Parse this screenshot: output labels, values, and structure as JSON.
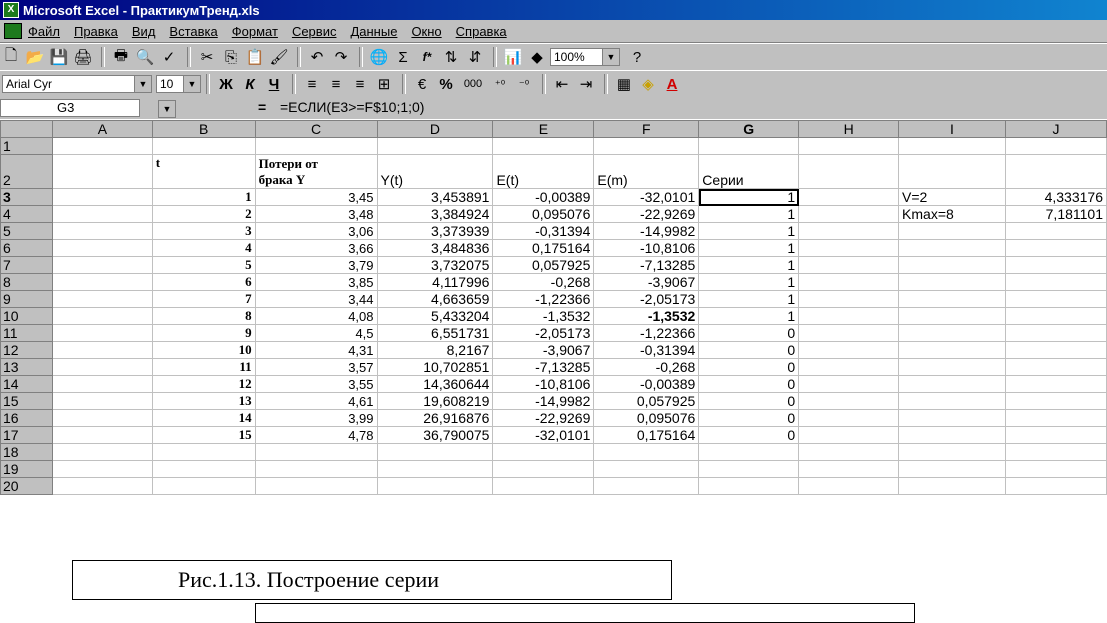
{
  "window": {
    "title": "Microsoft Excel - ПрактикумТренд.xls",
    "app_icon": "excel-icon"
  },
  "menu": [
    "Файл",
    "Правка",
    "Вид",
    "Вставка",
    "Формат",
    "Сервис",
    "Данные",
    "Окно",
    "Справка"
  ],
  "toolbar": {
    "zoom": "100%",
    "font": "Arial Cyr",
    "font_size": "10",
    "bold_label": "Ж",
    "italic_label": "К",
    "underline_label": "Ч",
    "percent": "%",
    "thousands": "000",
    "sigma": "Σ",
    "fx": "f*"
  },
  "formula_bar": {
    "cell_ref": "G3",
    "eq": "=",
    "formula": "=ЕСЛИ(E3>=F$10;1;0)"
  },
  "columns": [
    "A",
    "B",
    "C",
    "D",
    "E",
    "F",
    "G",
    "H",
    "I",
    "J"
  ],
  "rows": [
    {
      "n": "1",
      "a": "",
      "b": "",
      "c": "",
      "d": "",
      "e": "",
      "f": "",
      "g": "",
      "h": "",
      "i": "",
      "j": ""
    },
    {
      "n": "2",
      "a": "",
      "b": "t",
      "c1": "Потери от",
      "c": "брака Y",
      "d": "Y(t)",
      "e": "E(t)",
      "f": "E(m)",
      "g": "Серии",
      "h": "",
      "i": "",
      "j": ""
    },
    {
      "n": "3",
      "b": "1",
      "c": "3,45",
      "d": "3,453891",
      "e": "-0,00389",
      "f": "-32,0101",
      "g": "1",
      "i": "V=2",
      "j": "4,333176"
    },
    {
      "n": "4",
      "b": "2",
      "c": "3,48",
      "d": "3,384924",
      "e": "0,095076",
      "f": "-22,9269",
      "g": "1",
      "i": "Kmax=8",
      "j": "7,181101"
    },
    {
      "n": "5",
      "b": "3",
      "c": "3,06",
      "d": "3,373939",
      "e": "-0,31394",
      "f": "-14,9982",
      "g": "1",
      "i": "",
      "j": ""
    },
    {
      "n": "6",
      "b": "4",
      "c": "3,66",
      "d": "3,484836",
      "e": "0,175164",
      "f": "-10,8106",
      "g": "1",
      "i": "",
      "j": ""
    },
    {
      "n": "7",
      "b": "5",
      "c": "3,79",
      "d": "3,732075",
      "e": "0,057925",
      "f": "-7,13285",
      "g": "1",
      "i": "",
      "j": ""
    },
    {
      "n": "8",
      "b": "6",
      "c": "3,85",
      "d": "4,117996",
      "e": "-0,268",
      "f": "-3,9067",
      "g": "1",
      "i": "",
      "j": ""
    },
    {
      "n": "9",
      "b": "7",
      "c": "3,44",
      "d": "4,663659",
      "e": "-1,22366",
      "f": "-2,05173",
      "g": "1",
      "i": "",
      "j": ""
    },
    {
      "n": "10",
      "b": "8",
      "c": "4,08",
      "d": "5,433204",
      "e": "-1,3532",
      "f": "-1,3532",
      "g": "1",
      "i": "",
      "j": ""
    },
    {
      "n": "11",
      "b": "9",
      "c": "4,5",
      "d": "6,551731",
      "e": "-2,05173",
      "f": "-1,22366",
      "g": "0",
      "i": "",
      "j": ""
    },
    {
      "n": "12",
      "b": "10",
      "c": "4,31",
      "d": "8,2167",
      "e": "-3,9067",
      "f": "-0,31394",
      "g": "0",
      "i": "",
      "j": ""
    },
    {
      "n": "13",
      "b": "11",
      "c": "3,57",
      "d": "10,702851",
      "e": "-7,13285",
      "f": "-0,268",
      "g": "0",
      "i": "",
      "j": ""
    },
    {
      "n": "14",
      "b": "12",
      "c": "3,55",
      "d": "14,360644",
      "e": "-10,8106",
      "f": "-0,00389",
      "g": "0",
      "i": "",
      "j": ""
    },
    {
      "n": "15",
      "b": "13",
      "c": "4,61",
      "d": "19,608219",
      "e": "-14,9982",
      "f": "0,057925",
      "g": "0",
      "i": "",
      "j": ""
    },
    {
      "n": "16",
      "b": "14",
      "c": "3,99",
      "d": "26,916876",
      "e": "-22,9269",
      "f": "0,095076",
      "g": "0",
      "i": "",
      "j": ""
    },
    {
      "n": "17",
      "b": "15",
      "c": "4,78",
      "d": "36,790075",
      "e": "-32,0101",
      "f": "0,175164",
      "g": "0",
      "i": "",
      "j": ""
    },
    {
      "n": "18"
    },
    {
      "n": "19"
    },
    {
      "n": "20"
    }
  ],
  "caption": "Рис.1.13. Построение серии"
}
